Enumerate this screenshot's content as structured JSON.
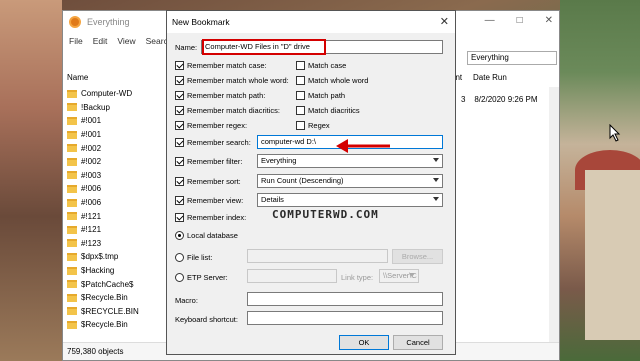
{
  "everything": {
    "title": "Everything",
    "menu": [
      "File",
      "Edit",
      "View",
      "Search"
    ],
    "column_name": "Name",
    "column_count": "unt",
    "column_date_run": "Date Run",
    "filter_value": "Everything",
    "row_count_value": "3",
    "row_date_value": "8/2/2020 9:26 PM",
    "status": "759,380 objects",
    "rows": [
      {
        "name": "Computer-WD",
        "icon": "folder-icon"
      },
      {
        "name": "!Backup",
        "icon": "folder-icon"
      },
      {
        "name": "#!001",
        "icon": "folder-icon"
      },
      {
        "name": "#!001",
        "icon": "folder-icon"
      },
      {
        "name": "#!002",
        "icon": "folder-icon"
      },
      {
        "name": "#!002",
        "icon": "folder-icon"
      },
      {
        "name": "#!003",
        "icon": "folder-icon"
      },
      {
        "name": "#!006",
        "icon": "folder-icon"
      },
      {
        "name": "#!006",
        "icon": "folder-icon"
      },
      {
        "name": "#!121",
        "icon": "folder-icon"
      },
      {
        "name": "#!121",
        "icon": "folder-icon"
      },
      {
        "name": "#!123",
        "icon": "folder-icon"
      },
      {
        "name": "$dpx$.tmp",
        "icon": "folder-icon"
      },
      {
        "name": "$Hacking",
        "icon": "folder-icon"
      },
      {
        "name": "$PatchCache$",
        "icon": "folder-icon"
      },
      {
        "name": "$Recycle.Bin",
        "icon": "folder-icon"
      },
      {
        "name": "$RECYCLE.BIN",
        "icon": "folder-icon"
      },
      {
        "name": "$Recycle.Bin",
        "icon": "folder-icon"
      }
    ],
    "controls": [
      "—",
      "□",
      "✕"
    ]
  },
  "dialog": {
    "title": "New Bookmark",
    "close_glyph": "✕",
    "name_label": "Name:",
    "name_value": "Computer-WD Files in \"D\" drive",
    "remember_match_case": "Remember match case:",
    "match_case": "Match case",
    "remember_whole_word": "Remember match whole word:",
    "match_whole_word": "Match whole word",
    "remember_match_path": "Remember match path:",
    "match_path": "Match path",
    "remember_diacritics": "Remember match diacritics:",
    "match_diacritics": "Match diacritics",
    "remember_regex": "Remember regex:",
    "regex": "Regex",
    "remember_search": "Remember search:",
    "search_value": "computer-wd D:\\",
    "remember_filter": "Remember filter:",
    "filter_value": "Everything",
    "remember_sort": "Remember sort:",
    "sort_value": "Run Count (Descending)",
    "remember_view": "Remember view:",
    "view_value": "Details",
    "remember_index": "Remember index:",
    "local_database": "Local database",
    "file_list": "File list:",
    "browse": "Browse...",
    "etp_server": "ETP Server:",
    "link_type": "Link type:",
    "link_type_value": "\\\\Server\\C",
    "macro": "Macro:",
    "keyboard_shortcut": "Keyboard shortcut:",
    "ok": "OK",
    "cancel": "Cancel"
  },
  "watermark": "COMPUTERWD.COM",
  "colors": {
    "highlight": "#d40000",
    "accent": "#0078d7"
  }
}
